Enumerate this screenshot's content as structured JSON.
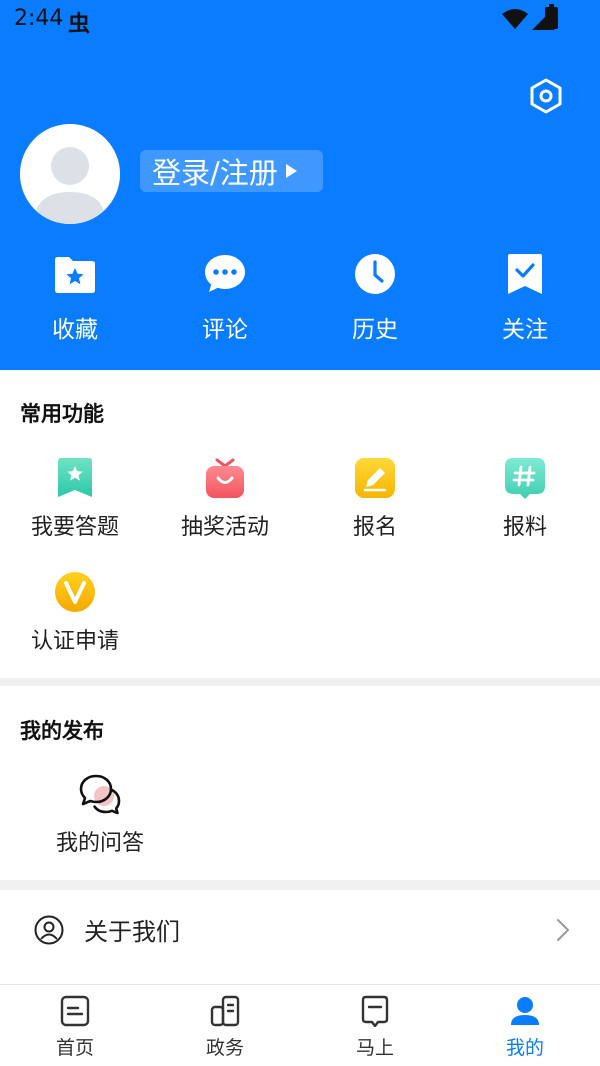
{
  "status_bar": {
    "time": "2:44",
    "notification_glyph": "虫"
  },
  "profile": {
    "login_label": "登录/注册"
  },
  "quick_actions": [
    {
      "label": "收藏",
      "icon": "star-folder-icon"
    },
    {
      "label": "评论",
      "icon": "comment-bubble-icon"
    },
    {
      "label": "历史",
      "icon": "clock-icon"
    },
    {
      "label": "关注",
      "icon": "bookmark-check-icon"
    }
  ],
  "common_functions": {
    "title": "常用功能",
    "items": [
      {
        "label": "我要答题",
        "icon": "star-bookmark-icon"
      },
      {
        "label": "抽奖活动",
        "icon": "gift-bag-icon"
      },
      {
        "label": "报名",
        "icon": "pencil-icon"
      },
      {
        "label": "报料",
        "icon": "hashtag-icon"
      },
      {
        "label": "认证申请",
        "icon": "verified-v-icon"
      }
    ]
  },
  "my_publish": {
    "title": "我的发布",
    "items": [
      {
        "label": "我的问答",
        "icon": "qa-bubbles-icon"
      }
    ]
  },
  "about": {
    "label": "关于我们"
  },
  "tabs": [
    {
      "label": "首页",
      "icon": "home-doc-icon",
      "active": false
    },
    {
      "label": "政务",
      "icon": "government-icon",
      "active": false
    },
    {
      "label": "马上",
      "icon": "bookmark-icon",
      "active": false
    },
    {
      "label": "我的",
      "icon": "user-icon",
      "active": true
    }
  ],
  "colors": {
    "primary": "#0a7cff",
    "background": "#f0f0f0"
  }
}
